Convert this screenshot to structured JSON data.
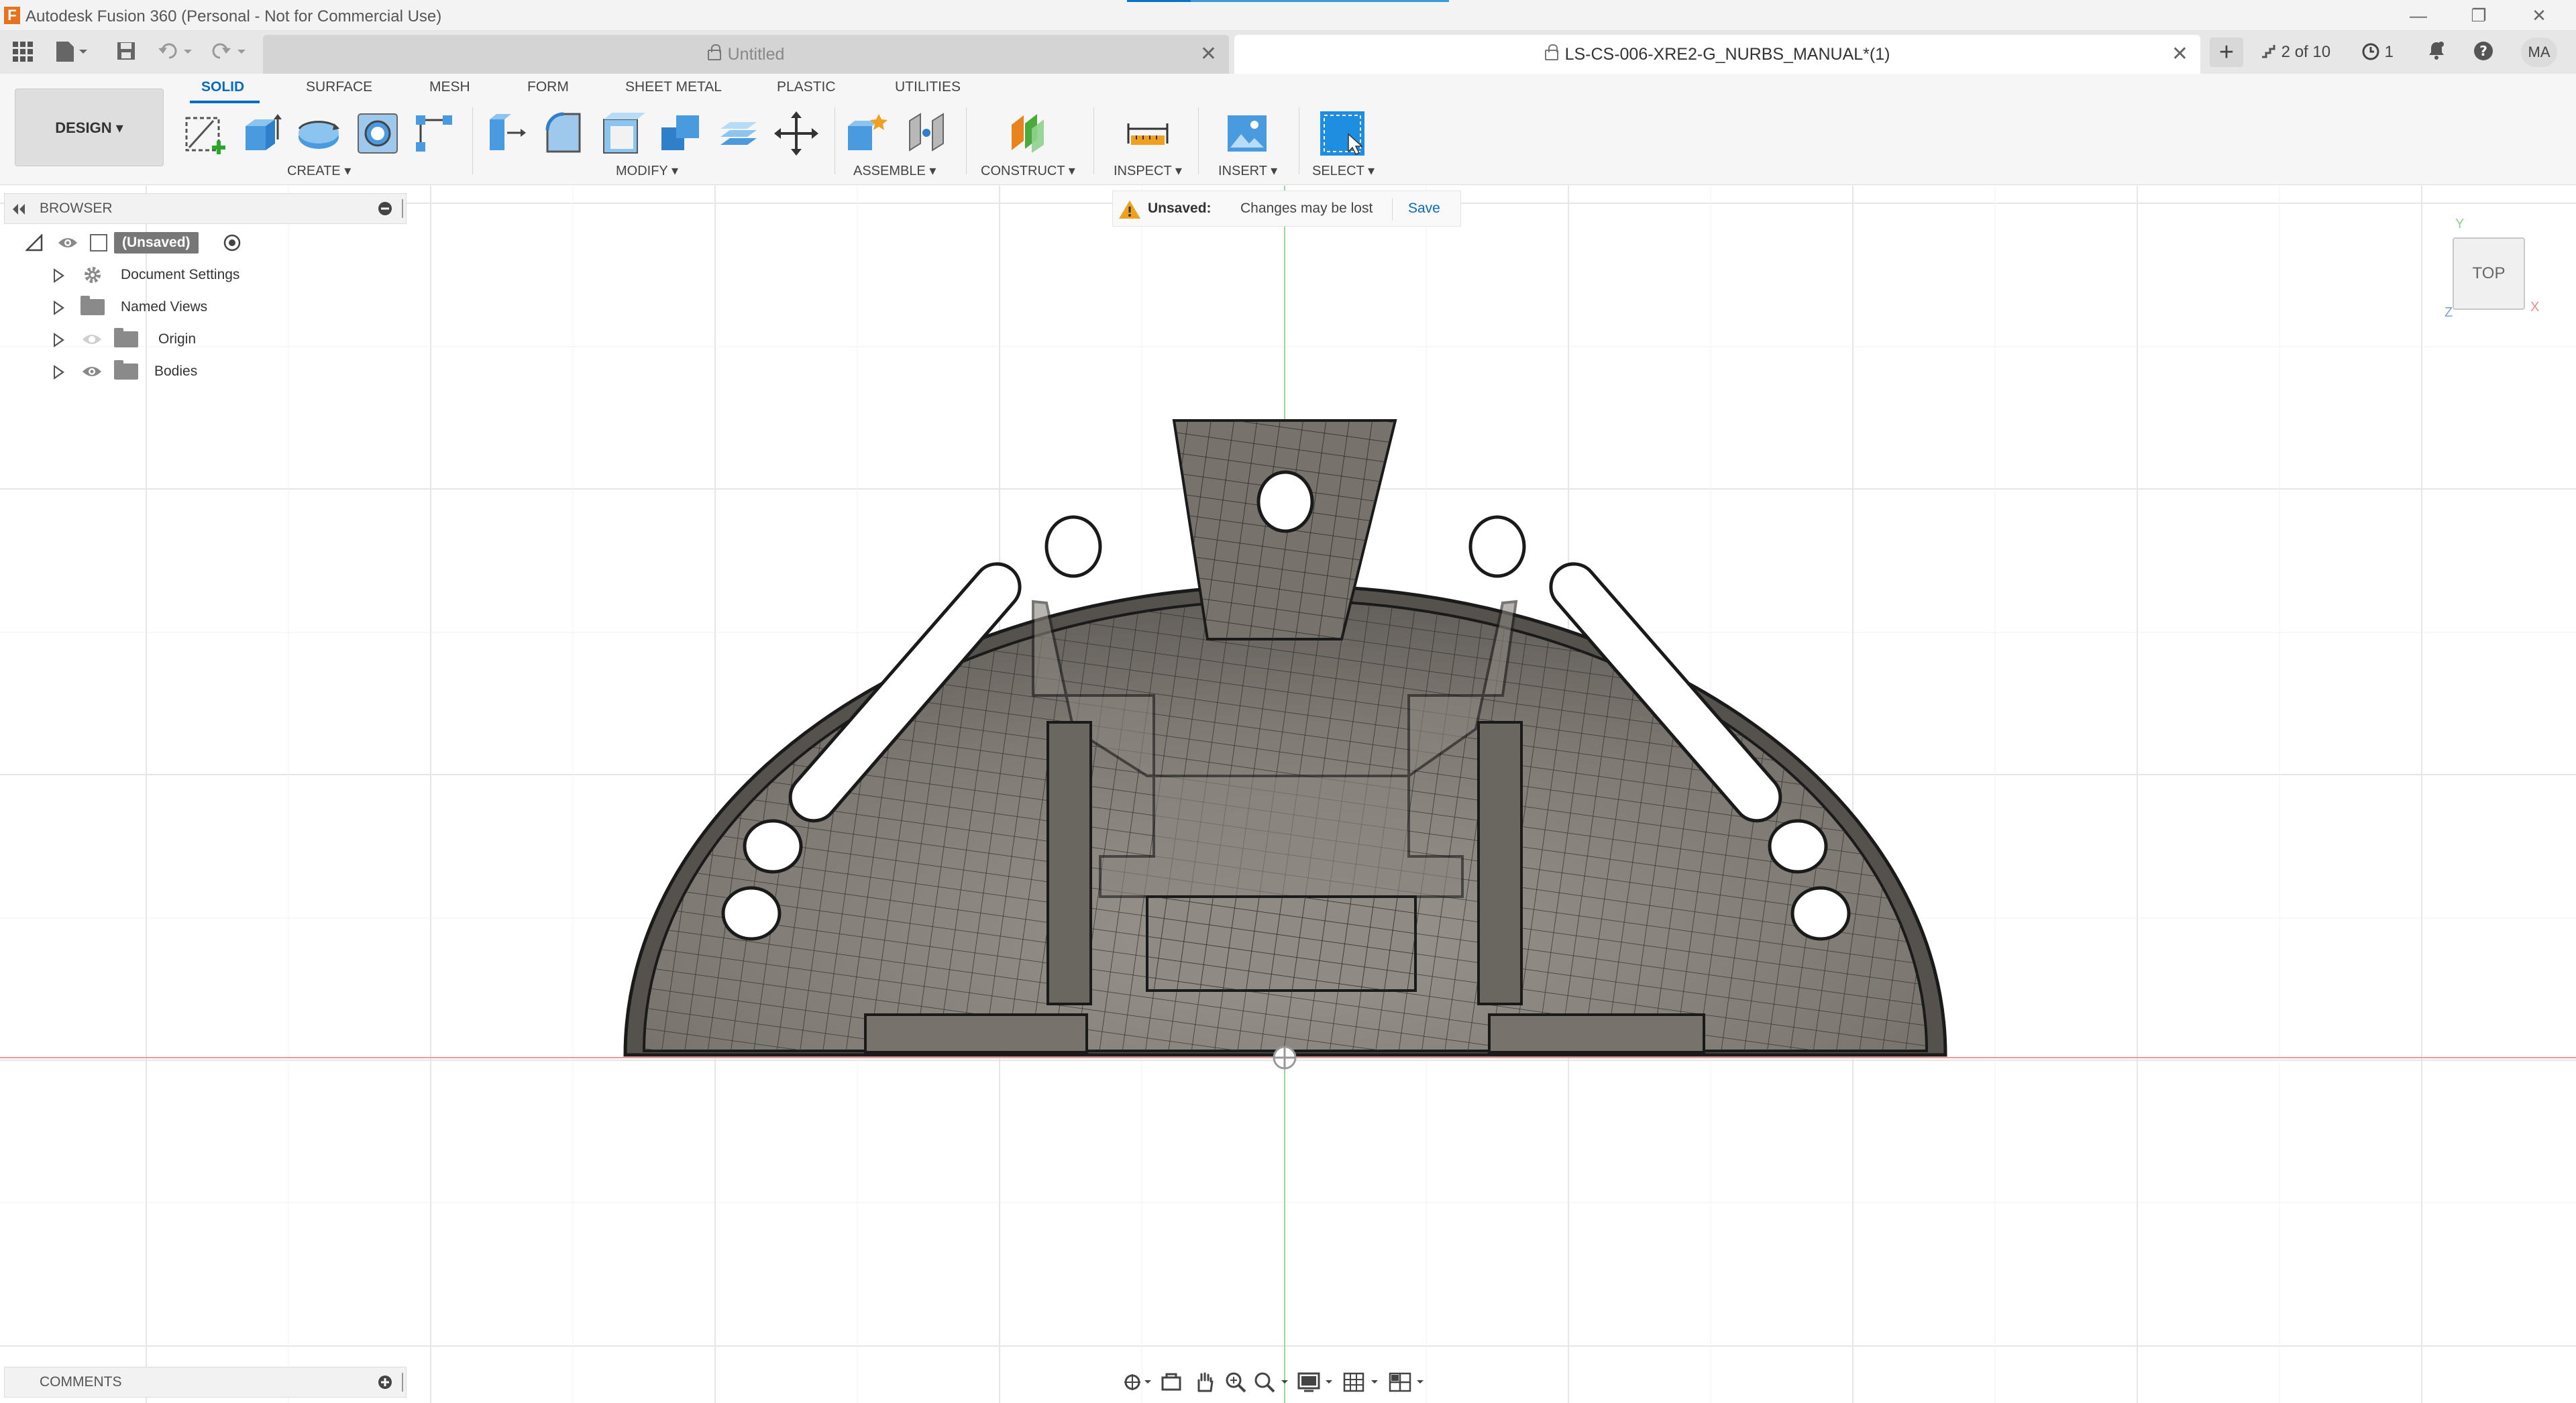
{
  "window": {
    "title": "Autodesk Fusion 360 (Personal - Not for Commercial Use)",
    "app_icon": "F",
    "minimize": "—",
    "restore": "❐",
    "close": "✕"
  },
  "tabs": {
    "untitled": "Untitled",
    "active": "LS-CS-006-XRE2-G_NURBS_MANUAL*(1)",
    "close_glyph": "✕",
    "new_tab": "+",
    "counter": "2 of 10",
    "jobs": "1",
    "user": "MA"
  },
  "toolbar": {
    "workspace": "DESIGN ▾",
    "tabs": [
      "SOLID",
      "SURFACE",
      "MESH",
      "FORM",
      "SHEET METAL",
      "PLASTIC",
      "UTILITIES"
    ],
    "active_tab": "SOLID",
    "groups": {
      "create": "CREATE ▾",
      "modify": "MODIFY ▾",
      "assemble": "ASSEMBLE ▾",
      "construct": "CONSTRUCT ▾",
      "inspect": "INSPECT ▾",
      "insert": "INSERT ▾",
      "select": "SELECT ▾"
    }
  },
  "banner": {
    "label": "Unsaved:",
    "message": "Changes may be lost",
    "save": "Save"
  },
  "browser": {
    "header": "BROWSER",
    "root": "(Unsaved)",
    "items": [
      "Document Settings",
      "Named Views",
      "Origin",
      "Bodies"
    ]
  },
  "comments": {
    "header": "COMMENTS"
  },
  "viewcube": {
    "face": "TOP",
    "axis_y": "Y",
    "axis_x": "X",
    "axis_z": "Z"
  },
  "colors": {
    "accent": "#0a6bc1",
    "part_fill": "#8f8a83",
    "grid": "#e2e2e2",
    "axis_red": "#e88c8c",
    "axis_green": "#8fd18f"
  }
}
